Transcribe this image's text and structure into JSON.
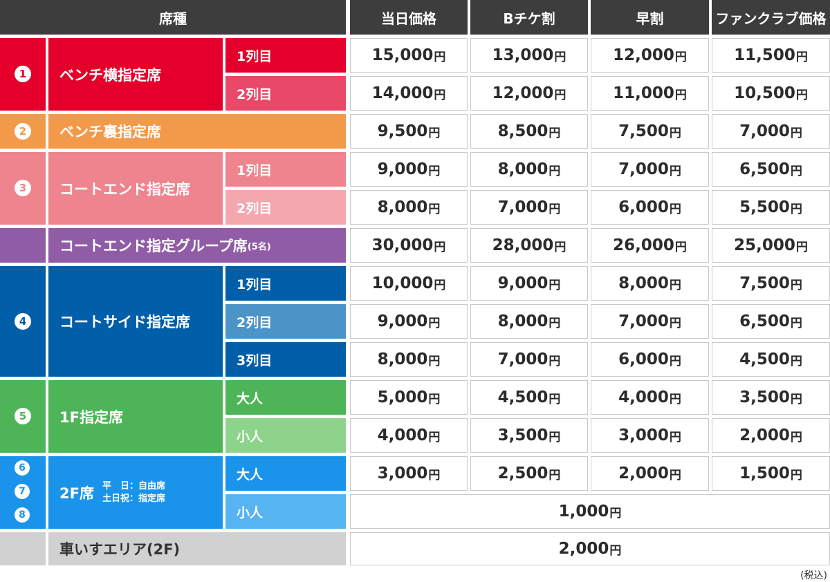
{
  "headers": {
    "seat_type": "席種",
    "cols": [
      "当日価格",
      "Bチケ割",
      "早割",
      "ファンクラブ価格"
    ]
  },
  "yen": "円",
  "tax_note": "(税込)",
  "colors": {
    "red": "#e4002b",
    "red_light": "#ea4869",
    "orange": "#f39a4a",
    "pink": "#ee858e",
    "pink_light": "#f4a7ae",
    "purple": "#8f5ca5",
    "navy": "#005fa8",
    "navy_light": "#4b94c8",
    "green": "#4db557",
    "green_light": "#8ed38b",
    "sky": "#1a94eb",
    "sky_light": "#56b4f2",
    "gray": "#d1d1d1"
  },
  "sections": {
    "s1": {
      "badge": "1",
      "name": "ベンチ横指定席"
    },
    "s2": {
      "badge": "2",
      "name": "ベンチ裏指定席"
    },
    "s3": {
      "badge": "3",
      "name": "コートエンド指定席"
    },
    "s3g": {
      "name": "コートエンド指定グループ席",
      "suffix": "(5名)"
    },
    "s4": {
      "badge": "4",
      "name": "コートサイド指定席"
    },
    "s5": {
      "badge": "5",
      "name": "1F指定席"
    },
    "s6": {
      "badges": [
        "6",
        "7",
        "8"
      ],
      "name": "2F席",
      "note_line1": "平　日：自由席",
      "note_line2": "土日祝：指定席"
    },
    "s7": {
      "name": "車いすエリア(2F)"
    }
  },
  "rows": [
    {
      "sub": "1列目",
      "prices": [
        "15,000",
        "13,000",
        "12,000",
        "11,500"
      ]
    },
    {
      "sub": "2列目",
      "prices": [
        "14,000",
        "12,000",
        "11,000",
        "10,500"
      ]
    },
    {
      "sub": "",
      "prices": [
        "9,500",
        "8,500",
        "7,500",
        "7,000"
      ]
    },
    {
      "sub": "1列目",
      "prices": [
        "9,000",
        "8,000",
        "7,000",
        "6,500"
      ]
    },
    {
      "sub": "2列目",
      "prices": [
        "8,000",
        "7,000",
        "6,000",
        "5,500"
      ]
    },
    {
      "sub": "",
      "prices": [
        "30,000",
        "28,000",
        "26,000",
        "25,000"
      ]
    },
    {
      "sub": "1列目",
      "prices": [
        "10,000",
        "9,000",
        "8,000",
        "7,500"
      ]
    },
    {
      "sub": "2列目",
      "prices": [
        "9,000",
        "8,000",
        "7,000",
        "6,500"
      ]
    },
    {
      "sub": "3列目",
      "prices": [
        "8,000",
        "7,000",
        "6,000",
        "4,500"
      ]
    },
    {
      "sub": "大人",
      "prices": [
        "5,000",
        "4,500",
        "4,000",
        "3,500"
      ]
    },
    {
      "sub": "小人",
      "prices": [
        "4,000",
        "3,500",
        "3,000",
        "2,000"
      ]
    },
    {
      "sub": "大人",
      "prices": [
        "3,000",
        "2,500",
        "2,000",
        "1,500"
      ]
    },
    {
      "sub": "小人",
      "prices": [
        "1,000"
      ]
    },
    {
      "sub": "",
      "prices": [
        "2,000"
      ]
    }
  ]
}
